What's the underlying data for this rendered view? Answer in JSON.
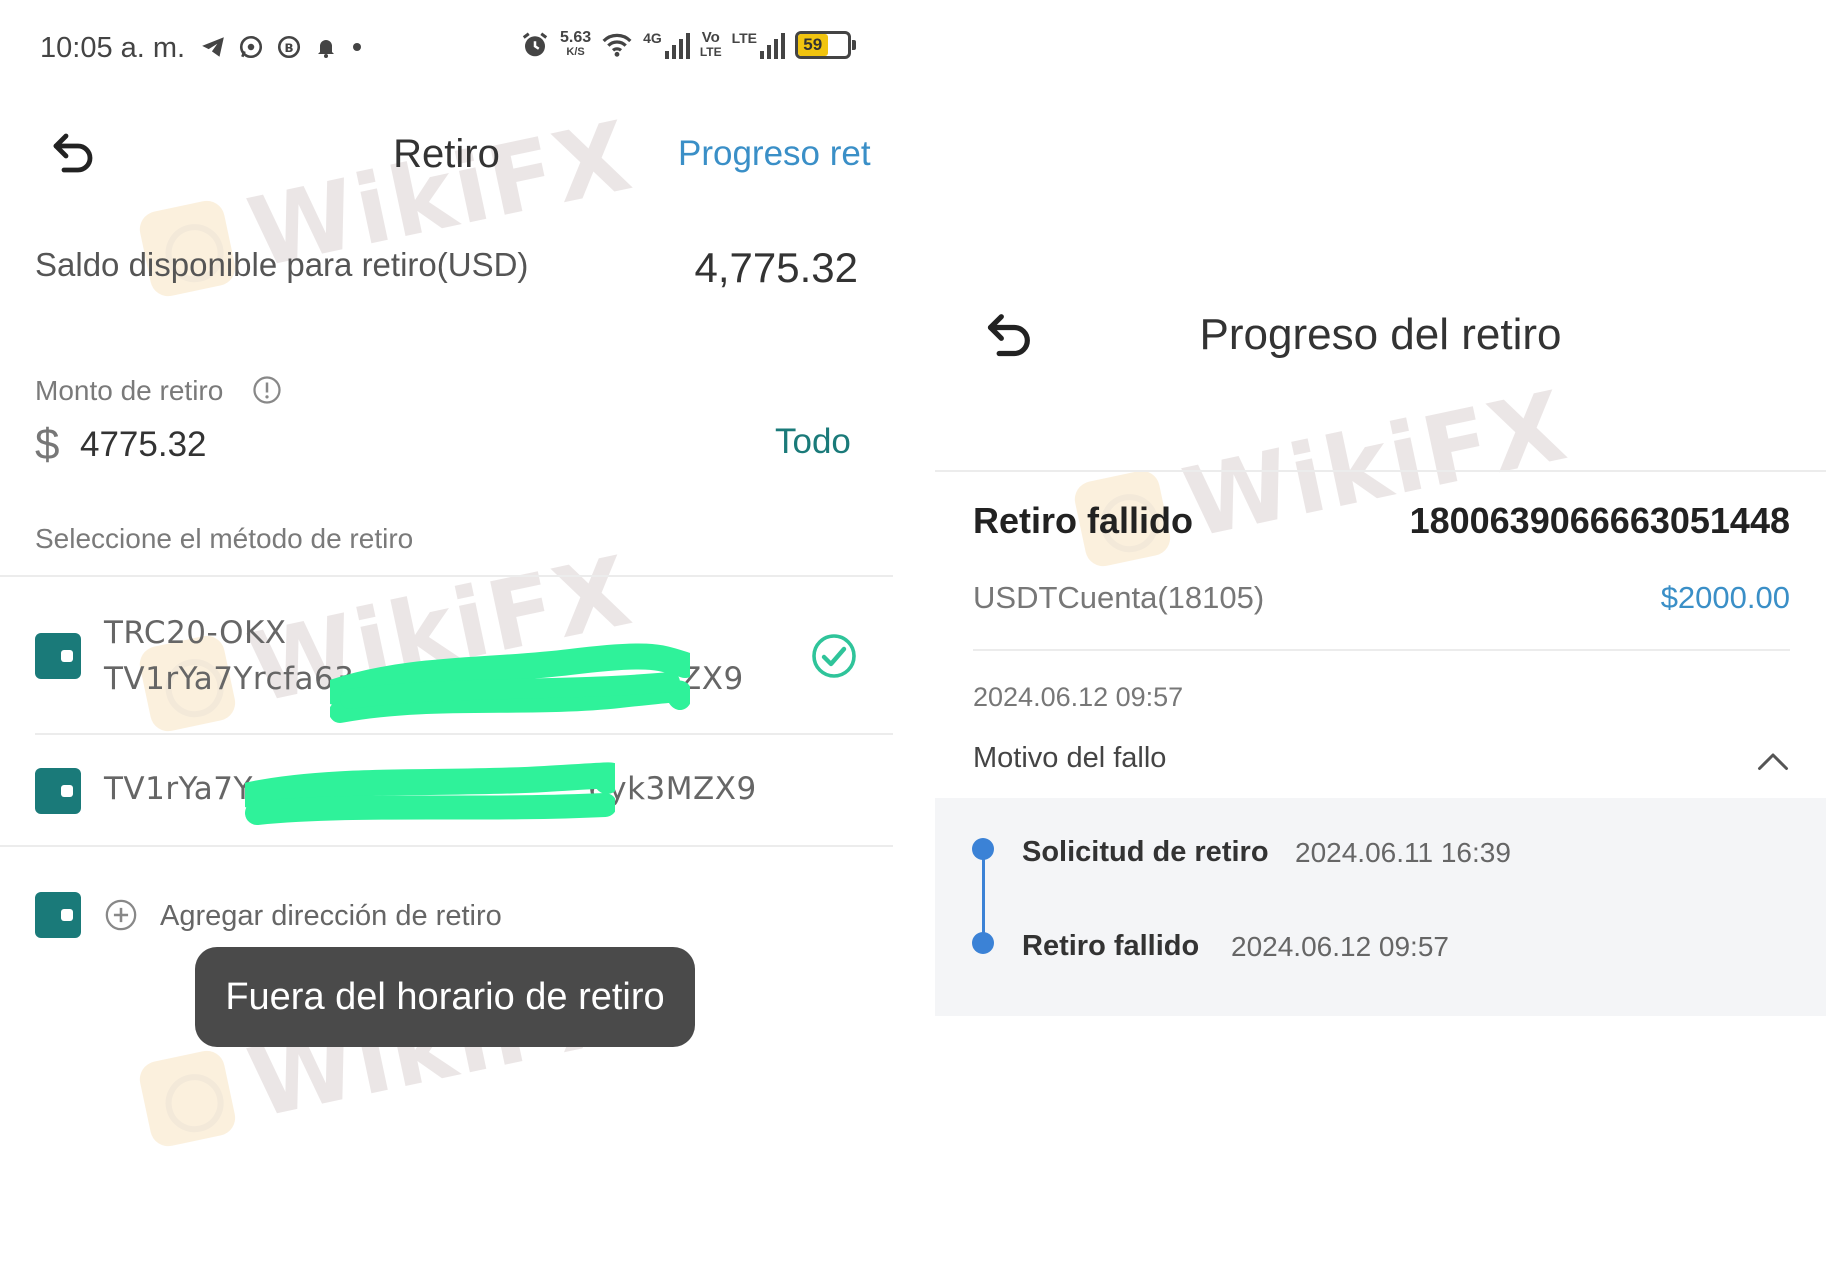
{
  "status_bar": {
    "time": "10:05 a. m.",
    "net_speed": "5.63",
    "net_speed_unit": "K/S",
    "network_4g": "4G",
    "volte_top": "Vo",
    "volte_bottom": "LTE",
    "lte": "LTE",
    "battery_level": "59",
    "battery_fraction": 0.59
  },
  "watermark": "WikiFX",
  "withdraw_screen": {
    "title": "Retiro",
    "progress_link": "Progreso ret",
    "balance_label": "Saldo disponible para retiro(USD)",
    "balance_value": "4,775.32",
    "amount_label": "Monto de retiro",
    "currency_symbol": "$",
    "amount_value": "4775.32",
    "all_button": "Todo",
    "method_label": "Seleccione el método de retiro",
    "methods": [
      {
        "name": "TRC20-OKX",
        "address_start": "TV1rYa7Yrcfa63",
        "address_end": "ZX9",
        "selected": true
      },
      {
        "address_start": "TV1rYa7Yr",
        "address_end": "6yk3MZX9",
        "selected": false
      }
    ],
    "add_address": "Agregar dirección de retiro",
    "toast": "Fuera del horario de retiro"
  },
  "progress_screen": {
    "title": "Progreso del retiro",
    "status": "Retiro fallido",
    "order_id": "1800639066663051448",
    "account": "USDTCuenta(18105)",
    "amount": "$2000.00",
    "datetime": "2024.06.12 09:57",
    "reason_label": "Motivo del fallo",
    "timeline": [
      {
        "label": "Solicitud de retiro",
        "time": "2024.06.11 16:39"
      },
      {
        "label": "Retiro fallido",
        "time": "2024.06.12 09:57"
      }
    ]
  },
  "colors": {
    "accent_link": "#3a8fc7",
    "wallet_teal": "#1a7a79",
    "check_green": "#2fc49a",
    "redaction_green": "#2ff29a",
    "timeline_blue": "#3b82d6",
    "toast_bg": "#4a4a4a"
  }
}
